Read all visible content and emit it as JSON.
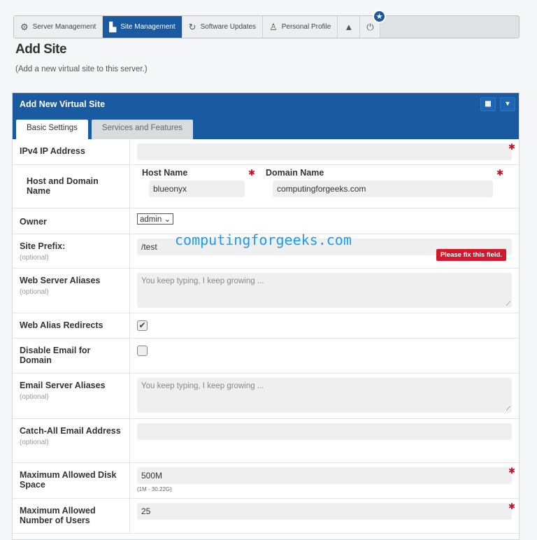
{
  "nav": {
    "items": [
      {
        "label": "Server Management",
        "icon": "gear-icon"
      },
      {
        "label": "Site Management",
        "icon": "layout-icon"
      },
      {
        "label": "Software Updates",
        "icon": "refresh-icon"
      },
      {
        "label": "Personal Profile",
        "icon": "user-icon"
      }
    ],
    "badge": "★"
  },
  "page": {
    "title": "Add Site",
    "subtitle": "(Add a new virtual site to this server.)"
  },
  "panel": {
    "title": "Add New Virtual Site",
    "tabs": [
      "Basic Settings",
      "Services and Features"
    ]
  },
  "form": {
    "ipv4": {
      "label": "IPv4 IP Address",
      "value": ""
    },
    "host_domain": {
      "label": "Host and Domain Name",
      "host_label": "Host Name",
      "host_value": "blueonyx",
      "domain_label": "Domain Name",
      "domain_value": "computingforgeeks.com"
    },
    "owner": {
      "label": "Owner",
      "value": "admin"
    },
    "prefix": {
      "label": "Site Prefix:",
      "optional": "(optional)",
      "value": "/test",
      "error": "Please fix this field."
    },
    "web_aliases": {
      "label": "Web Server Aliases",
      "optional": "(optional)",
      "placeholder": "You keep typing, I keep growing ..."
    },
    "web_redirects": {
      "label": "Web Alias Redirects",
      "checked": true
    },
    "disable_email": {
      "label": "Disable Email for Domain",
      "checked": false
    },
    "email_aliases": {
      "label": "Email Server Aliases",
      "optional": "(optional)",
      "placeholder": "You keep typing, I keep growing ..."
    },
    "catch_all": {
      "label": "Catch-All Email Address",
      "optional": "(optional)",
      "value": ""
    },
    "disk": {
      "label": "Maximum Allowed Disk Space",
      "value": "500M",
      "hint": "(1M - 30.22G)"
    },
    "users": {
      "label": "Maximum Allowed Number of Users",
      "value": "25"
    }
  },
  "watermark": "computingforgeeks.com"
}
